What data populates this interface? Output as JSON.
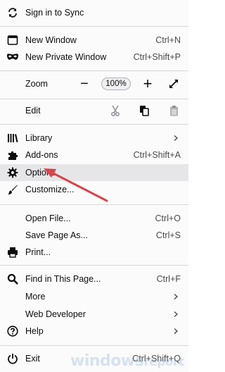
{
  "menu": {
    "sign_in": {
      "label": "Sign in to Sync"
    },
    "new_window": {
      "label": "New Window",
      "shortcut": "Ctrl+N"
    },
    "new_private": {
      "label": "New Private Window",
      "shortcut": "Ctrl+Shift+P"
    },
    "zoom": {
      "label": "Zoom",
      "minus": "−",
      "value": "100%",
      "plus": "+"
    },
    "edit": {
      "label": "Edit"
    },
    "library": {
      "label": "Library"
    },
    "addons": {
      "label": "Add-ons",
      "shortcut": "Ctrl+Shift+A"
    },
    "options": {
      "label": "Options"
    },
    "customize": {
      "label": "Customize..."
    },
    "open_file": {
      "label": "Open File...",
      "shortcut": "Ctrl+O"
    },
    "save_page": {
      "label": "Save Page As...",
      "shortcut": "Ctrl+S"
    },
    "print": {
      "label": "Print..."
    },
    "find": {
      "label": "Find in This Page...",
      "shortcut": "Ctrl+F"
    },
    "more": {
      "label": "More"
    },
    "web_dev": {
      "label": "Web Developer"
    },
    "help": {
      "label": "Help"
    },
    "exit": {
      "label": "Exit",
      "shortcut": "Ctrl+Shift+Q"
    }
  },
  "watermark": {
    "text": "windows",
    "suffix": "report"
  },
  "colors": {
    "highlight": "#e6e6e8",
    "arrow": "#d9434a",
    "separator": "#d7d7db"
  },
  "icons": {
    "sign_in": "sync-icon",
    "new_window": "new-window-icon",
    "new_private": "private-mask-icon",
    "fullscreen": "fullscreen-icon",
    "cut": "scissors-icon",
    "copy": "copy-icon",
    "paste": "paste-icon",
    "library": "library-icon",
    "addons": "puzzle-icon",
    "options": "gear-icon",
    "customize": "paintbrush-icon",
    "print": "printer-icon",
    "find": "search-icon",
    "help": "help-icon",
    "exit": "power-icon"
  }
}
